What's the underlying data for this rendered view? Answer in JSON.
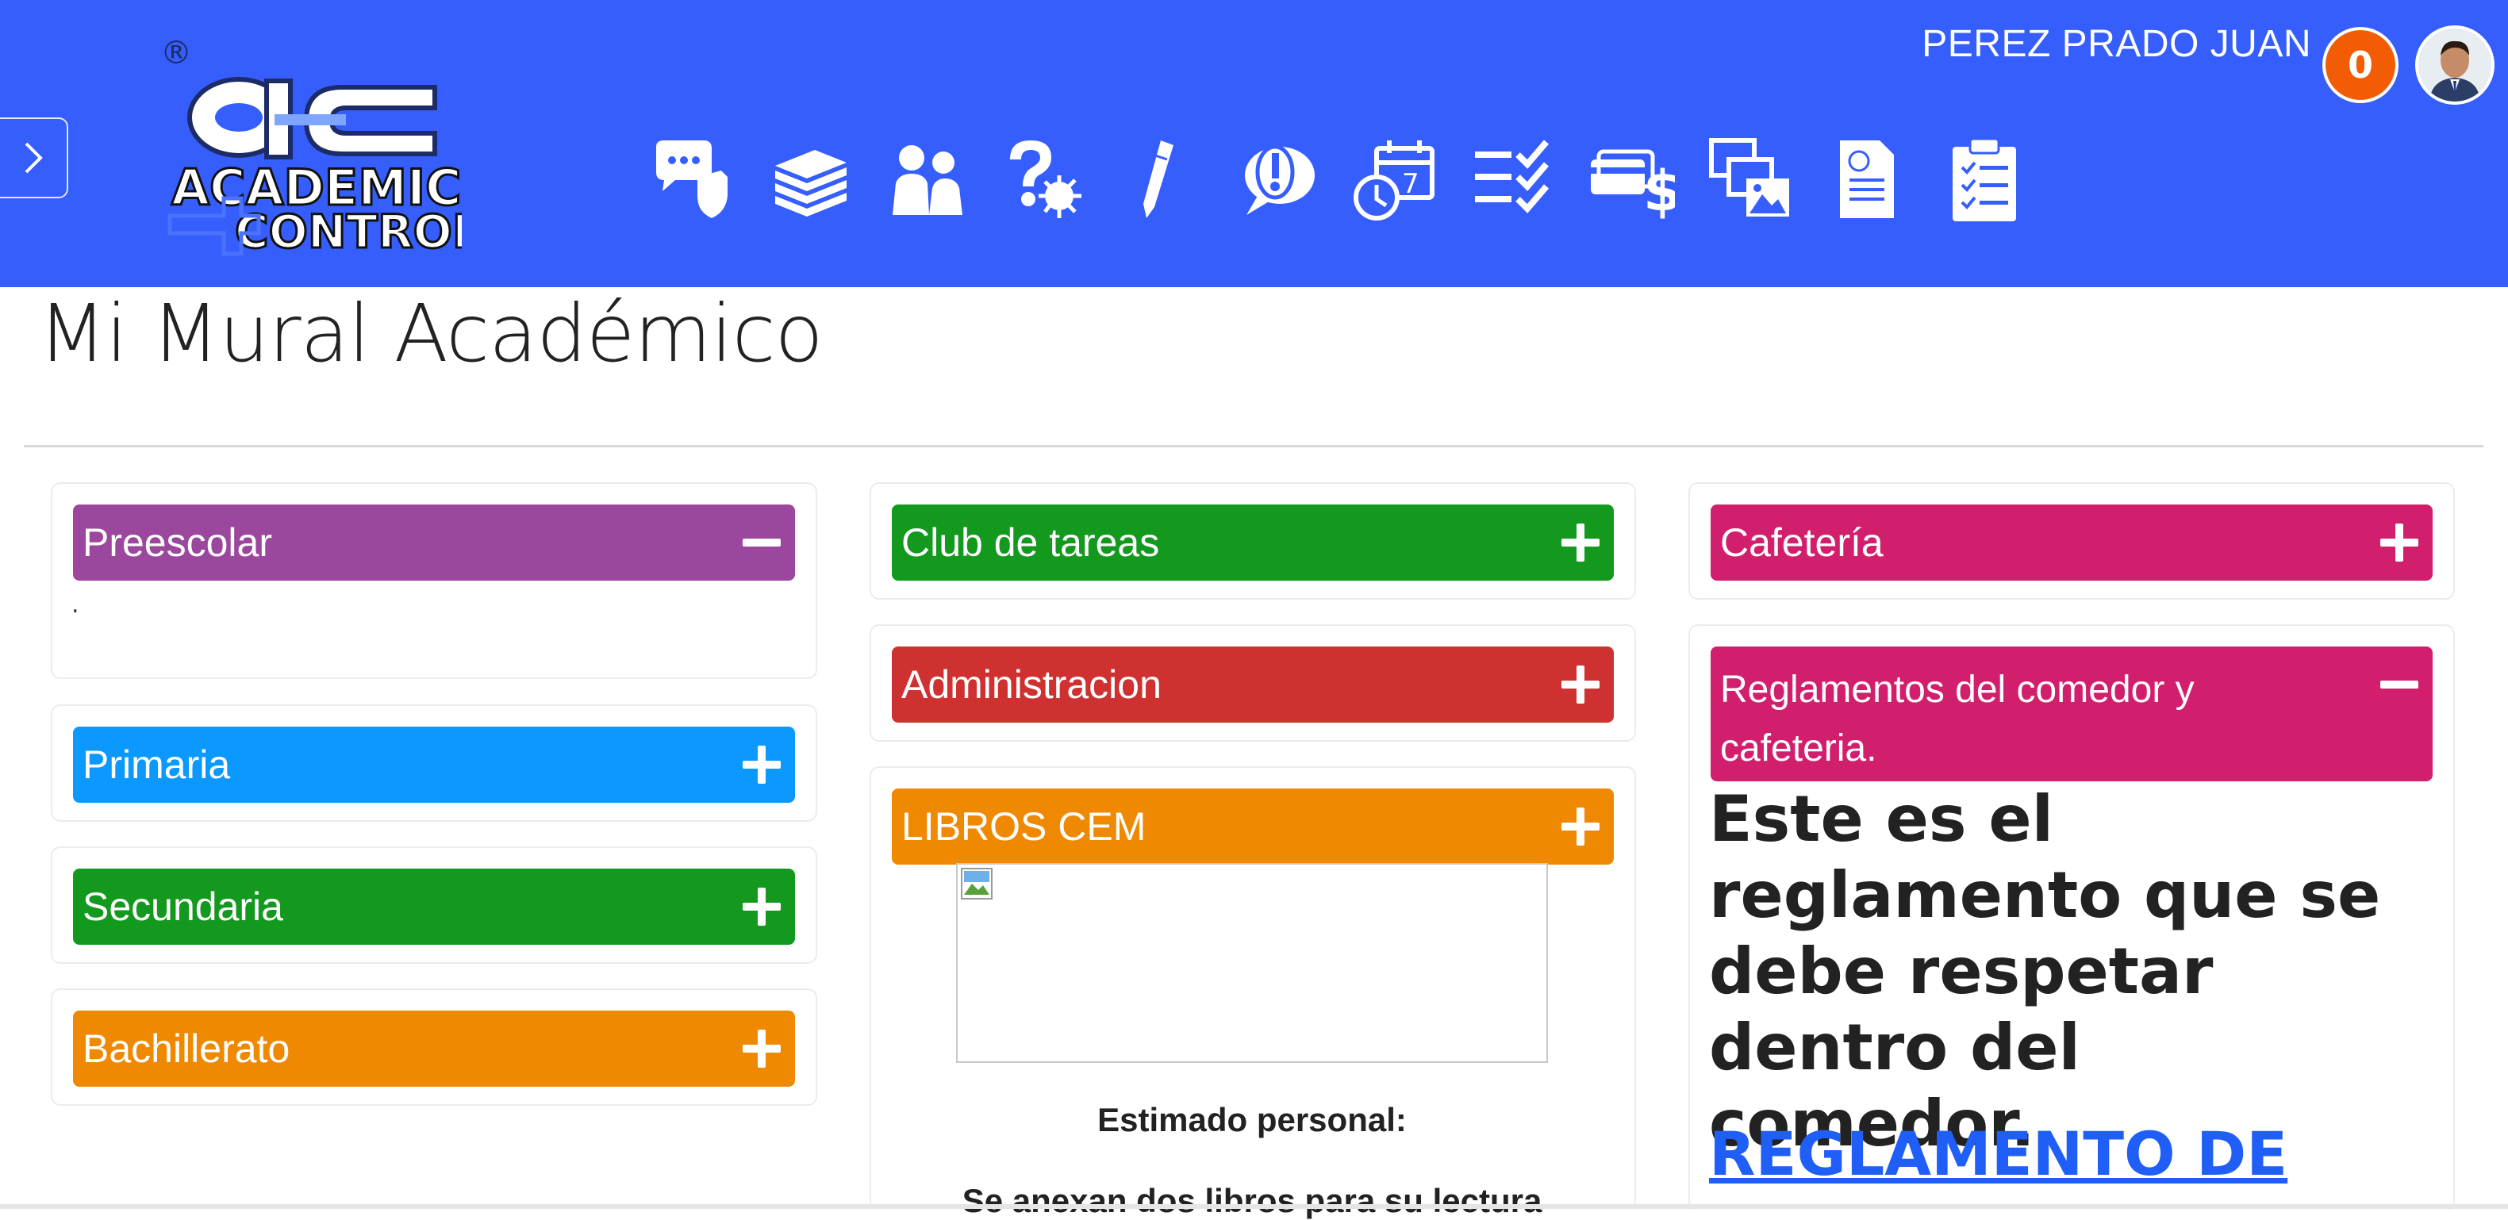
{
  "header": {
    "user_name": "PEREZ PRADO JUAN",
    "notification_count": "0",
    "background_color": "#355efd",
    "logo": {
      "line1": "ACADEMIC",
      "line2": "CONTROL",
      "mark": "aC",
      "registered": "®"
    },
    "nav_icons": [
      "chat-security-icon",
      "books-icon",
      "people-icon",
      "question-virus-icon",
      "pencil-icon",
      "alert-chat-icon",
      "calendar-clock-icon",
      "checklist-icon",
      "payment-card-icon",
      "gallery-icon",
      "document-icon",
      "clipboard-list-icon"
    ],
    "calendar_icon_number": "7"
  },
  "page": {
    "title": "Mi Mural Académico"
  },
  "columns": {
    "left": [
      {
        "label": "Preescolar",
        "state": "expanded",
        "color": "#9b479e",
        "body_text": "."
      },
      {
        "label": "Primaria",
        "state": "collapsed",
        "color": "#0b99ff"
      },
      {
        "label": "Secundaria",
        "state": "collapsed",
        "color": "#12991e"
      },
      {
        "label": "Bachillerato",
        "state": "collapsed",
        "color": "#ef8902"
      }
    ],
    "middle": [
      {
        "label": "Club de tareas",
        "state": "collapsed",
        "color": "#12991e"
      },
      {
        "label": "Administracion",
        "state": "collapsed",
        "color": "#cf3131"
      },
      {
        "label": "LIBROS CEM",
        "state": "collapsed",
        "color": "#ef8902"
      }
    ],
    "right": [
      {
        "label": "Cafetería",
        "state": "collapsed",
        "color": "#d21f6d"
      },
      {
        "label_line1": "Reglamentos del comedor y",
        "label_line2": "cafeteria.",
        "state": "expanded",
        "color": "#d21f6d"
      }
    ]
  },
  "libros": {
    "greeting": "Estimado personal:",
    "cut_text": "Se anexan dos libros para su lectura"
  },
  "reglamento": {
    "text": "Este es el reglamento que se debe respetar dentro del comedor.",
    "link_text": "REGLAMENTO DE"
  }
}
